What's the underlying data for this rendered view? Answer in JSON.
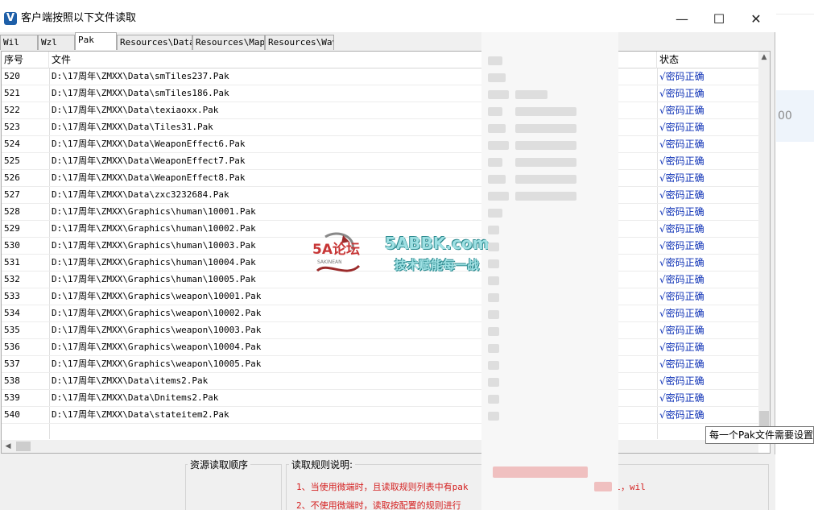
{
  "window": {
    "title": "客户端按照以下文件读取",
    "icon_letter": "V",
    "minimize": "—",
    "maximize": "☐",
    "close": "✕"
  },
  "tabs": [
    "Wil",
    "Wzl",
    "Pak",
    "Resources\\Data",
    "Resources\\Map",
    "Resources\\Wav"
  ],
  "active_tab": "Pak",
  "columns": {
    "index": "序号",
    "file": "文件",
    "status": "状态"
  },
  "rows": [
    {
      "index": "520",
      "file": "D:\\17周年\\ZMXX\\Data\\smTiles237.Pak",
      "status": "√密码正确"
    },
    {
      "index": "521",
      "file": "D:\\17周年\\ZMXX\\Data\\smTiles186.Pak",
      "status": "√密码正确"
    },
    {
      "index": "522",
      "file": "D:\\17周年\\ZMXX\\Data\\texiaoxx.Pak",
      "status": "√密码正确"
    },
    {
      "index": "523",
      "file": "D:\\17周年\\ZMXX\\Data\\Tiles31.Pak",
      "status": "√密码正确"
    },
    {
      "index": "524",
      "file": "D:\\17周年\\ZMXX\\Data\\WeaponEffect6.Pak",
      "status": "√密码正确"
    },
    {
      "index": "525",
      "file": "D:\\17周年\\ZMXX\\Data\\WeaponEffect7.Pak",
      "status": "√密码正确"
    },
    {
      "index": "526",
      "file": "D:\\17周年\\ZMXX\\Data\\WeaponEffect8.Pak",
      "status": "√密码正确"
    },
    {
      "index": "527",
      "file": "D:\\17周年\\ZMXX\\Data\\zxc3232684.Pak",
      "status": "√密码正确"
    },
    {
      "index": "528",
      "file": "D:\\17周年\\ZMXX\\Graphics\\human\\10001.Pak",
      "status": "√密码正确"
    },
    {
      "index": "529",
      "file": "D:\\17周年\\ZMXX\\Graphics\\human\\10002.Pak",
      "status": "√密码正确"
    },
    {
      "index": "530",
      "file": "D:\\17周年\\ZMXX\\Graphics\\human\\10003.Pak",
      "status": "√密码正确"
    },
    {
      "index": "531",
      "file": "D:\\17周年\\ZMXX\\Graphics\\human\\10004.Pak",
      "status": "√密码正确"
    },
    {
      "index": "532",
      "file": "D:\\17周年\\ZMXX\\Graphics\\human\\10005.Pak",
      "status": "√密码正确"
    },
    {
      "index": "533",
      "file": "D:\\17周年\\ZMXX\\Graphics\\weapon\\10001.Pak",
      "status": "√密码正确"
    },
    {
      "index": "534",
      "file": "D:\\17周年\\ZMXX\\Graphics\\weapon\\10002.Pak",
      "status": "√密码正确"
    },
    {
      "index": "535",
      "file": "D:\\17周年\\ZMXX\\Graphics\\weapon\\10003.Pak",
      "status": "√密码正确"
    },
    {
      "index": "536",
      "file": "D:\\17周年\\ZMXX\\Graphics\\weapon\\10004.Pak",
      "status": "√密码正确"
    },
    {
      "index": "537",
      "file": "D:\\17周年\\ZMXX\\Graphics\\weapon\\10005.Pak",
      "status": "√密码正确"
    },
    {
      "index": "538",
      "file": "D:\\17周年\\ZMXX\\Data\\items2.Pak",
      "status": "√密码正确"
    },
    {
      "index": "539",
      "file": "D:\\17周年\\ZMXX\\Data\\Dnitems2.Pak",
      "status": "√密码正确"
    },
    {
      "index": "540",
      "file": "D:\\17周年\\ZMXX\\Data\\stateitem2.Pak",
      "status": "√密码正确"
    }
  ],
  "bottom": {
    "order_title": "资源读取顺序",
    "rules_title": "读取规则说明:",
    "rule1_prefix": "1、当使用微端时，且读取规则列表中有pak",
    "rule1_suffix": "读 wzl，wil",
    "rule2": "2、不使用微端时，读取按配置的规则进行"
  },
  "tooltip": "每一个Pak文件需要设置",
  "watermark": {
    "logo_text": "5A论坛",
    "logo_sub": "SAKINEAN",
    "site": "5ABBK.com",
    "slogan": "技术赋能每一战"
  },
  "background_right_text": "00",
  "icons": {
    "scroll_up": "▲",
    "scroll_left": "◀"
  }
}
